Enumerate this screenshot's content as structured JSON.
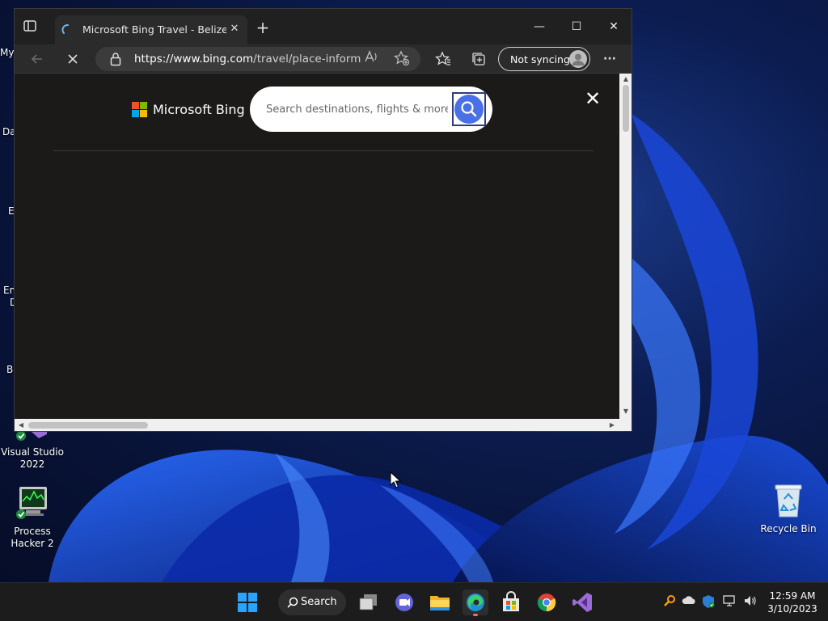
{
  "browser": {
    "tab_title": "Microsoft Bing Travel - Belize City",
    "tab_close_glyph": "✕",
    "new_tab_glyph": "+",
    "window_controls": {
      "minimize": "—",
      "maximize": "☐",
      "close": "✕"
    },
    "url_domain": "https://www.bing.com",
    "url_path": "/travel/place-inform...",
    "sync_label": "Not syncing",
    "more_glyph": "···"
  },
  "page": {
    "brand": "Microsoft Bing",
    "search_placeholder": "Search destinations, flights & more",
    "close_glyph": "✕"
  },
  "desktop": {
    "icons": [
      {
        "label": "Visual Studio 2022"
      },
      {
        "label": "Process Hacker 2"
      },
      {
        "label": "Recycle Bin"
      }
    ],
    "partial_labels": [
      "My",
      "Da",
      "E",
      "Em",
      "D",
      "Ba"
    ]
  },
  "taskbar": {
    "search_label": "Search",
    "time": "12:59 AM",
    "date": "3/10/2023"
  },
  "colors": {
    "bing_red": "#f25022",
    "bing_green": "#7fba00",
    "bing_blue": "#00a4ef",
    "bing_yellow": "#ffb900",
    "search_accent": "#4a70e8"
  }
}
